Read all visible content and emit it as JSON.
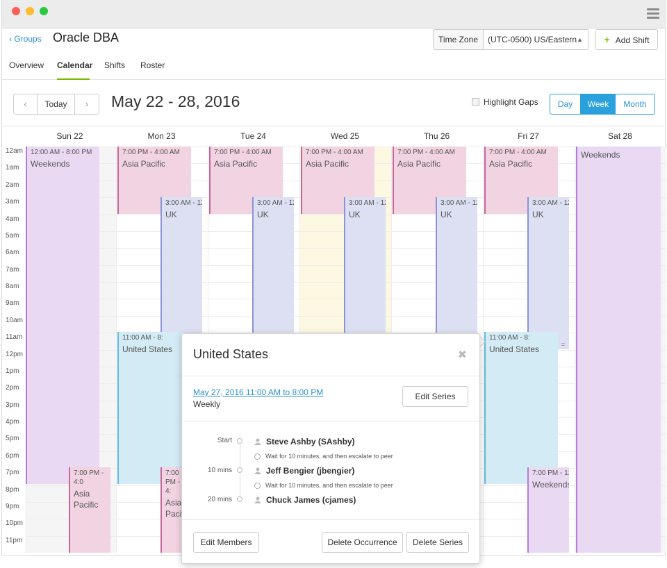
{
  "window": {
    "colors": {
      "close": "#fe5f57",
      "minimize": "#febc2e",
      "maximize": "#28c840"
    },
    "menu_icon": "hamburger-icon"
  },
  "header": {
    "back_label": "Groups",
    "title": "Oracle DBA",
    "tabs": [
      {
        "label": "Overview"
      },
      {
        "label": "Calendar",
        "active": true
      },
      {
        "label": "Shifts"
      },
      {
        "label": "Roster"
      }
    ],
    "timezone_label": "Time Zone",
    "timezone_value": "(UTC-0500) US/Eastern",
    "add_shift_label": "Add Shift"
  },
  "toolbar": {
    "prev_icon": "chevron-left-icon",
    "today_label": "Today",
    "next_icon": "chevron-right-icon",
    "date_range": "May 22 - 28, 2016",
    "highlight_gaps_label": "Highlight Gaps",
    "views": [
      {
        "label": "Day"
      },
      {
        "label": "Week",
        "selected": true
      },
      {
        "label": "Month"
      }
    ]
  },
  "calendar": {
    "days": [
      "Sun 22",
      "Mon 23",
      "Tue 24",
      "Wed 25",
      "Thu 26",
      "Fri 27",
      "Sat 28"
    ],
    "hours": [
      "12am",
      "1am",
      "2am",
      "3am",
      "4am",
      "5am",
      "6am",
      "7am",
      "8am",
      "9am",
      "10am",
      "11am",
      "12pm",
      "1pm",
      "2pm",
      "3pm",
      "4pm",
      "5pm",
      "6pm",
      "7pm",
      "8pm",
      "9pm",
      "10pm",
      "11pm"
    ],
    "event_colors": {
      "pink": "#f2d3e2",
      "blue": "#dde0f3",
      "purple": "#ead9f2",
      "cyan": "#d3ebf5"
    },
    "events": [
      {
        "time": "12:00 AM - 8:00 PM",
        "name": "Weekends"
      },
      {
        "time": "7:00 PM - 4:0",
        "name": "Asia Pacific"
      },
      {
        "time": "7:00 PM - 4:00 AM",
        "name": "Asia Pacific"
      },
      {
        "time": "3:00 AM - 12",
        "name": "UK"
      },
      {
        "time": "11:00 AM - 8:",
        "name": "United States"
      },
      {
        "time": "7:00 PM - 4:",
        "name": "Asia Pacific"
      },
      {
        "time": "7:00 PM - 4:00 AM",
        "name": "Asia Pacific"
      },
      {
        "time": "3:00 AM - 12",
        "name": "UK"
      },
      {
        "time": "7:00 PM - 4:00 AM",
        "name": "Asia Pacific"
      },
      {
        "time": "3:00 AM - 12",
        "name": "UK"
      },
      {
        "time": "7:00 PM - 4:00 AM",
        "name": "Asia Pacific"
      },
      {
        "time": "3:00 AM - 12",
        "name": "UK"
      },
      {
        "time": "7:00 PM - 4:00 AM",
        "name": "Asia Pacific"
      },
      {
        "time": "3:00 AM - 12",
        "name": "UK"
      },
      {
        "time": "11:00 AM - 8:",
        "name": "United States"
      },
      {
        "time": "7:00 PM - 12",
        "name": "Weekends"
      },
      {
        "name": "Weekends"
      }
    ]
  },
  "popover": {
    "title": "United States",
    "close_icon": "close-icon",
    "date_link": "May 27, 2016 11:00 AM to 8:00 PM",
    "recurrence": "Weekly",
    "edit_series_label": "Edit Series",
    "escalation": [
      {
        "label": "Start",
        "person": "Steve Ashby (SAshby)",
        "wait": "Wait for 10 minutes, and then escalate to peer"
      },
      {
        "label": "10 mins",
        "person": "Jeff Bengier (jbengier)",
        "wait": "Wait for 10 minutes, and then escalate to peer"
      },
      {
        "label": "20 mins",
        "person": "Chuck James (cjames)"
      }
    ],
    "edit_members_label": "Edit Members",
    "delete_occurrence_label": "Delete Occurrence",
    "delete_series_label": "Delete Series"
  }
}
